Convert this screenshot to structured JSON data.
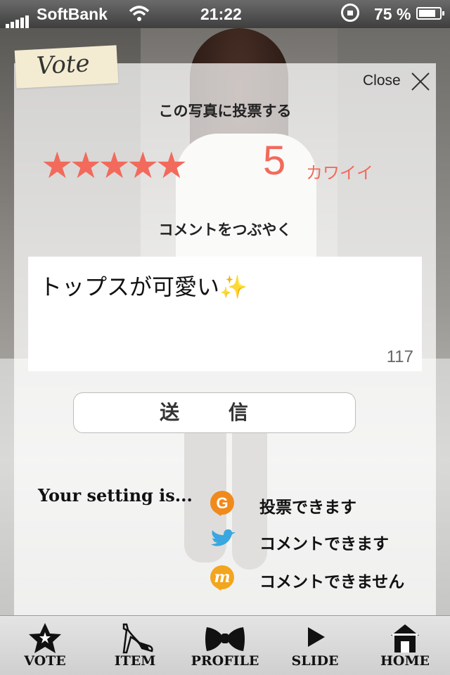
{
  "status_bar": {
    "carrier": "SoftBank",
    "time": "21:22",
    "battery": "75 %"
  },
  "panel": {
    "tag": "Vote",
    "close_label": "Close",
    "vote_heading": "この写真に投票する",
    "rating": {
      "stars": "★★★★★",
      "max": 5,
      "value": "5",
      "word": "カワイイ"
    },
    "comment_heading": "コメントをつぶやく",
    "comment": {
      "text": "トップスが可愛い✨",
      "counter": "117"
    },
    "send_label": "送 信",
    "setting_label": "Your setting is...",
    "services": [
      {
        "icon": "g-service-icon",
        "color": "#f08a1c",
        "text": "投票できます"
      },
      {
        "icon": "twitter-bird-icon",
        "color": "#3aa7e0",
        "text": "コメントできます"
      },
      {
        "icon": "m-service-icon",
        "color": "#f2a51e",
        "text": "コメントできません"
      }
    ]
  },
  "tabbar": {
    "tabs": [
      {
        "label": "VOTE",
        "icon": "star-icon"
      },
      {
        "label": "ITEM",
        "icon": "high-heel-icon"
      },
      {
        "label": "PROFILE",
        "icon": "bow-icon"
      },
      {
        "label": "SLIDE",
        "icon": "play-icon"
      },
      {
        "label": "HOME",
        "icon": "house-icon"
      }
    ]
  },
  "colors": {
    "accent": "#f26a5b",
    "tag_paper": "#f3ecd2"
  }
}
